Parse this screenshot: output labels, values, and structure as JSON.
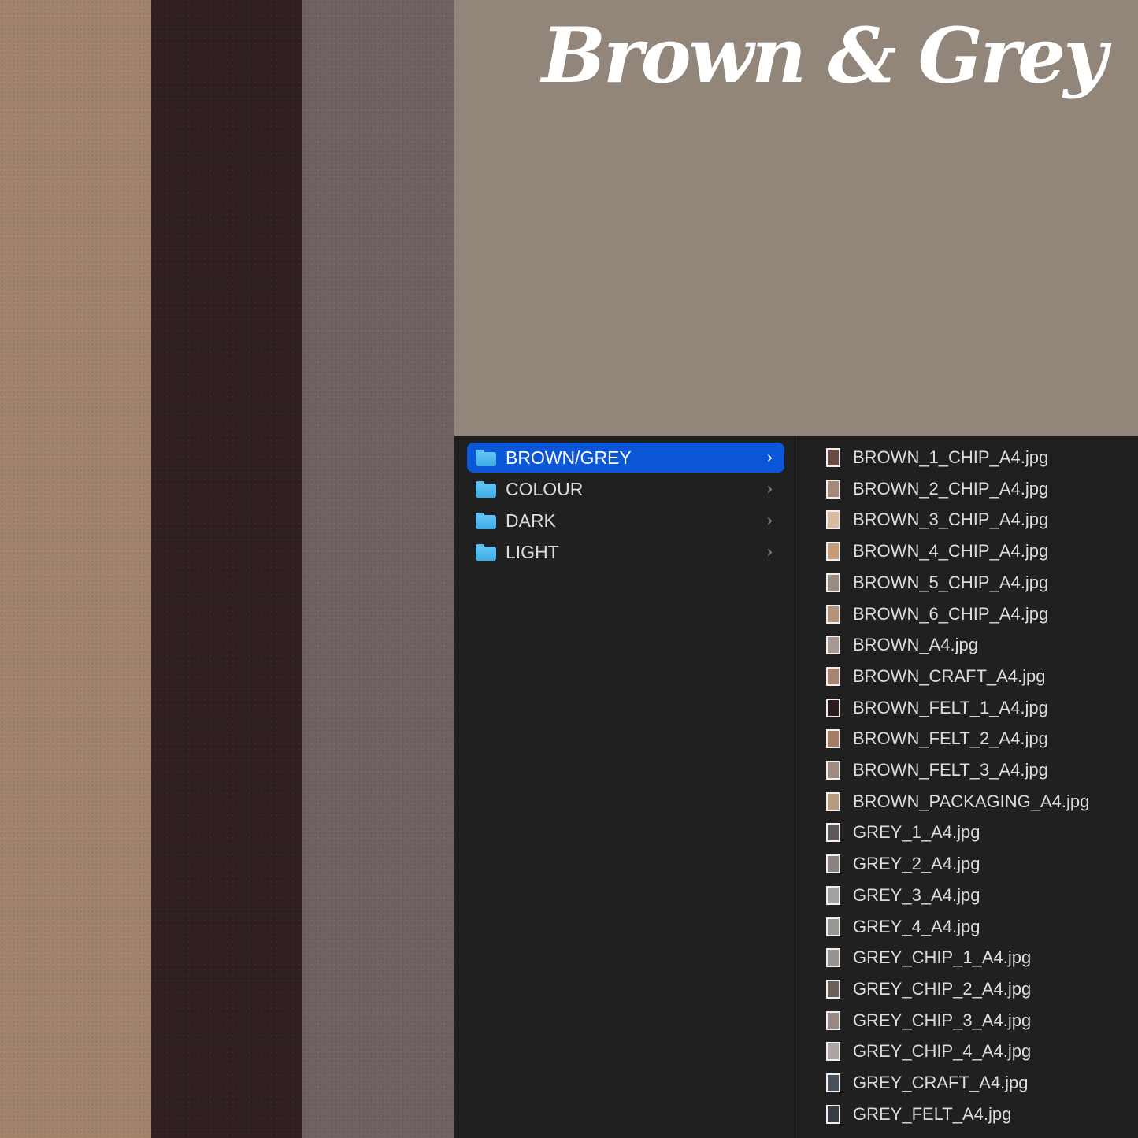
{
  "title": "Brown & Grey",
  "colors": {
    "hero_bg": "#928579",
    "finder_bg": "#1f201f",
    "selection": "#0b57d8",
    "folder_blue": "#4cb4ea",
    "text": "#dcdcdc"
  },
  "swatches": [
    {
      "name": "kraft-brown-paper",
      "color": "#a1836c"
    },
    {
      "name": "dark-brown-felt",
      "color": "#2f1f1e"
    },
    {
      "name": "grey-brown-paper",
      "color": "#6e6263"
    }
  ],
  "folders": [
    {
      "label": "BROWN/GREY",
      "selected": true
    },
    {
      "label": "COLOUR",
      "selected": false
    },
    {
      "label": "DARK",
      "selected": false
    },
    {
      "label": "LIGHT",
      "selected": false
    }
  ],
  "files": [
    {
      "name": "BROWN_1_CHIP_A4.jpg",
      "thumb": "#6a4d42"
    },
    {
      "name": "BROWN_2_CHIP_A4.jpg",
      "thumb": "#a58a7a"
    },
    {
      "name": "BROWN_3_CHIP_A4.jpg",
      "thumb": "#d6bc9c"
    },
    {
      "name": "BROWN_4_CHIP_A4.jpg",
      "thumb": "#c79b78"
    },
    {
      "name": "BROWN_5_CHIP_A4.jpg",
      "thumb": "#9b8c80"
    },
    {
      "name": "BROWN_6_CHIP_A4.jpg",
      "thumb": "#b59278"
    },
    {
      "name": "BROWN_A4.jpg",
      "thumb": "#a89893"
    },
    {
      "name": "BROWN_CRAFT_A4.jpg",
      "thumb": "#a8846e"
    },
    {
      "name": "BROWN_FELT_1_A4.jpg",
      "thumb": "#2c1c1c"
    },
    {
      "name": "BROWN_FELT_2_A4.jpg",
      "thumb": "#a57c66"
    },
    {
      "name": "BROWN_FELT_3_A4.jpg",
      "thumb": "#a08b82"
    },
    {
      "name": "BROWN_PACKAGING_A4.jpg",
      "thumb": "#b79b80"
    },
    {
      "name": "GREY_1_A4.jpg",
      "thumb": "#5f5658"
    },
    {
      "name": "GREY_2_A4.jpg",
      "thumb": "#8c8282"
    },
    {
      "name": "GREY_3_A4.jpg",
      "thumb": "#a4a1a1"
    },
    {
      "name": "GREY_4_A4.jpg",
      "thumb": "#999793"
    },
    {
      "name": "GREY_CHIP_1_A4.jpg",
      "thumb": "#9a928d"
    },
    {
      "name": "GREY_CHIP_2_A4.jpg",
      "thumb": "#6e5f5d"
    },
    {
      "name": "GREY_CHIP_3_A4.jpg",
      "thumb": "#978883"
    },
    {
      "name": "GREY_CHIP_4_A4.jpg",
      "thumb": "#aea3a3"
    },
    {
      "name": "GREY_CRAFT_A4.jpg",
      "thumb": "#48505a"
    },
    {
      "name": "GREY_FELT_A4.jpg",
      "thumb": "#383c45"
    }
  ]
}
